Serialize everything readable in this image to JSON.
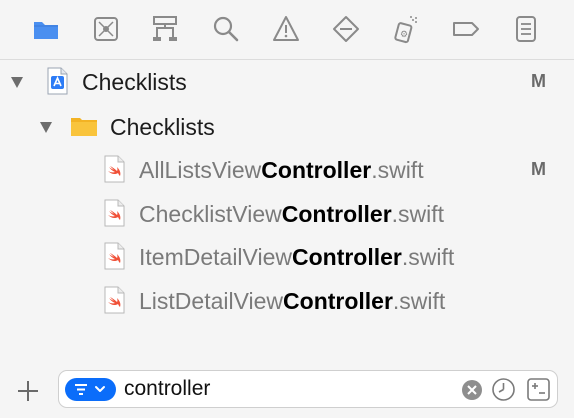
{
  "toolbar": {
    "icons": [
      "project-navigator-icon",
      "source-control-navigator-icon",
      "symbol-navigator-icon",
      "find-navigator-icon",
      "issue-navigator-icon",
      "test-navigator-icon",
      "debug-navigator-icon",
      "breakpoint-navigator-icon",
      "report-navigator-icon"
    ],
    "active": "project-navigator-icon",
    "accent": "#3b82f6"
  },
  "tree": {
    "project": {
      "name": "Checklists",
      "status": "M"
    },
    "group": {
      "name": "Checklists"
    },
    "files": [
      {
        "prefix": "AllListsView",
        "match": "Controller",
        "suffix": ".swift",
        "status": "M"
      },
      {
        "prefix": "ChecklistView",
        "match": "Controller",
        "suffix": ".swift",
        "status": ""
      },
      {
        "prefix": "ItemDetailView",
        "match": "Controller",
        "suffix": ".swift",
        "status": ""
      },
      {
        "prefix": "ListDetailView",
        "match": "Controller",
        "suffix": ".swift",
        "status": ""
      }
    ]
  },
  "bottom": {
    "add_icon": "plus-icon",
    "filter_value": "controller",
    "filter_icon": "filter-options-icon",
    "clear_icon": "clear-icon",
    "recent_icon": "clock-icon",
    "scm_icon": "scm-status-icon"
  },
  "colors": {
    "folder": "#f9c43c",
    "swift": "#f05138",
    "filter_pill": "#0b6dfa"
  }
}
